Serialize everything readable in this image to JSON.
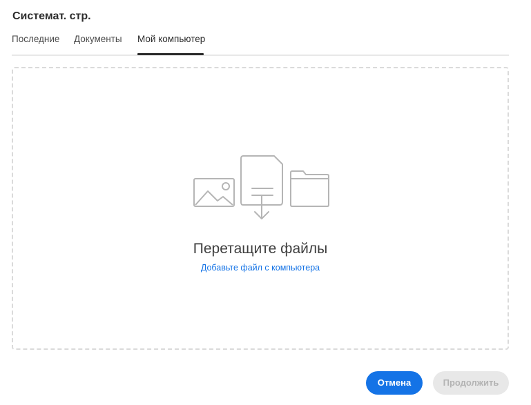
{
  "dialog": {
    "title": "Системат. стр."
  },
  "tabs": [
    {
      "label": "Последние",
      "selected": false
    },
    {
      "label": "Документы",
      "selected": false
    },
    {
      "label": "Мой компьютер",
      "selected": true
    }
  ],
  "dropzone": {
    "icons": [
      "image-icon",
      "document-download-icon",
      "folder-icon"
    ],
    "title": "Перетащите файлы",
    "link_label": "Добавьте файл с компьютера"
  },
  "footer": {
    "cancel_label": "Отмена",
    "continue_label": "Продолжить",
    "continue_disabled": true
  },
  "colors": {
    "accent": "#1473e6",
    "icon_stroke": "#b5b5b5",
    "disabled_bg": "#e8e8e8"
  }
}
